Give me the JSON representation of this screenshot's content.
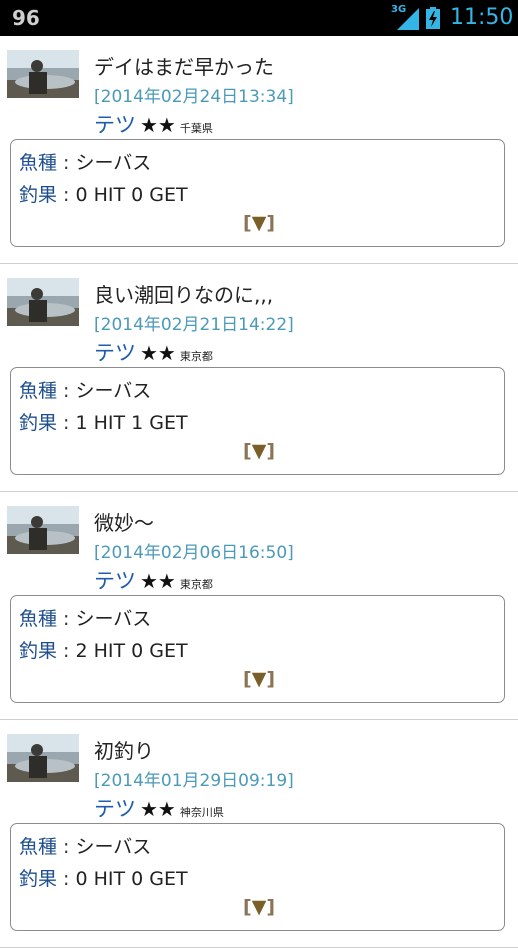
{
  "statusbar": {
    "notification": "96",
    "network": "3G",
    "time": "11:50"
  },
  "entries": [
    {
      "title": "デイはまだ早かった",
      "date": "[2014年02月24日13:34]",
      "user": "テツ",
      "rank": "★★",
      "prefecture": "千葉県",
      "species_label": "魚種",
      "species_value": "シーバス",
      "result_label": "釣果",
      "result_value": "0 HIT 0 GET",
      "expand_open": "[",
      "expand_tri": "▼",
      "expand_close": "]"
    },
    {
      "title": "良い潮回りなのに,,,",
      "date": "[2014年02月21日14:22]",
      "user": "テツ",
      "rank": "★★",
      "prefecture": "東京都",
      "species_label": "魚種",
      "species_value": "シーバス",
      "result_label": "釣果",
      "result_value": "1 HIT 1 GET",
      "expand_open": "[",
      "expand_tri": "▼",
      "expand_close": "]"
    },
    {
      "title": "微妙～",
      "date": "[2014年02月06日16:50]",
      "user": "テツ",
      "rank": "★★",
      "prefecture": "東京都",
      "species_label": "魚種",
      "species_value": "シーバス",
      "result_label": "釣果",
      "result_value": "2 HIT 0 GET",
      "expand_open": "[",
      "expand_tri": "▼",
      "expand_close": "]"
    },
    {
      "title": "初釣り",
      "date": "[2014年01月29日09:19]",
      "user": "テツ",
      "rank": "★★",
      "prefecture": "神奈川県",
      "species_label": "魚種",
      "species_value": "シーバス",
      "result_label": "釣果",
      "result_value": "0 HIT 0 GET",
      "expand_open": "[",
      "expand_tri": "▼",
      "expand_close": "]"
    }
  ],
  "colors": {
    "date": "#4a9ab8",
    "user": "#1f5da8",
    "label": "#1f4f8f",
    "expand": "#7a6028",
    "status_accent": "#33b5e5"
  }
}
